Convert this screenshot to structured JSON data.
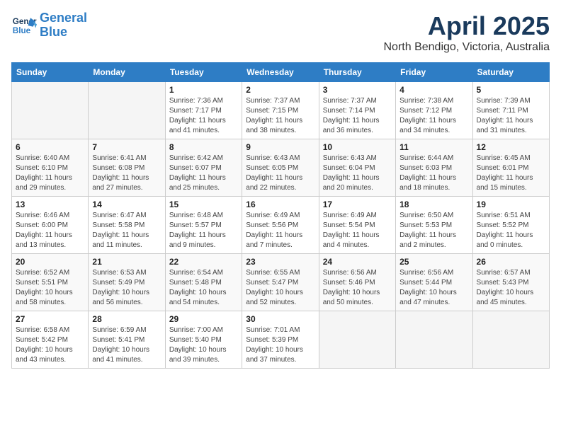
{
  "logo": {
    "line1": "General",
    "line2": "Blue"
  },
  "title": "April 2025",
  "subtitle": "North Bendigo, Victoria, Australia",
  "days_header": [
    "Sunday",
    "Monday",
    "Tuesday",
    "Wednesday",
    "Thursday",
    "Friday",
    "Saturday"
  ],
  "weeks": [
    [
      {
        "day": "",
        "info": ""
      },
      {
        "day": "",
        "info": ""
      },
      {
        "day": "1",
        "info": "Sunrise: 7:36 AM\nSunset: 7:17 PM\nDaylight: 11 hours and 41 minutes."
      },
      {
        "day": "2",
        "info": "Sunrise: 7:37 AM\nSunset: 7:15 PM\nDaylight: 11 hours and 38 minutes."
      },
      {
        "day": "3",
        "info": "Sunrise: 7:37 AM\nSunset: 7:14 PM\nDaylight: 11 hours and 36 minutes."
      },
      {
        "day": "4",
        "info": "Sunrise: 7:38 AM\nSunset: 7:12 PM\nDaylight: 11 hours and 34 minutes."
      },
      {
        "day": "5",
        "info": "Sunrise: 7:39 AM\nSunset: 7:11 PM\nDaylight: 11 hours and 31 minutes."
      }
    ],
    [
      {
        "day": "6",
        "info": "Sunrise: 6:40 AM\nSunset: 6:10 PM\nDaylight: 11 hours and 29 minutes."
      },
      {
        "day": "7",
        "info": "Sunrise: 6:41 AM\nSunset: 6:08 PM\nDaylight: 11 hours and 27 minutes."
      },
      {
        "day": "8",
        "info": "Sunrise: 6:42 AM\nSunset: 6:07 PM\nDaylight: 11 hours and 25 minutes."
      },
      {
        "day": "9",
        "info": "Sunrise: 6:43 AM\nSunset: 6:05 PM\nDaylight: 11 hours and 22 minutes."
      },
      {
        "day": "10",
        "info": "Sunrise: 6:43 AM\nSunset: 6:04 PM\nDaylight: 11 hours and 20 minutes."
      },
      {
        "day": "11",
        "info": "Sunrise: 6:44 AM\nSunset: 6:03 PM\nDaylight: 11 hours and 18 minutes."
      },
      {
        "day": "12",
        "info": "Sunrise: 6:45 AM\nSunset: 6:01 PM\nDaylight: 11 hours and 15 minutes."
      }
    ],
    [
      {
        "day": "13",
        "info": "Sunrise: 6:46 AM\nSunset: 6:00 PM\nDaylight: 11 hours and 13 minutes."
      },
      {
        "day": "14",
        "info": "Sunrise: 6:47 AM\nSunset: 5:58 PM\nDaylight: 11 hours and 11 minutes."
      },
      {
        "day": "15",
        "info": "Sunrise: 6:48 AM\nSunset: 5:57 PM\nDaylight: 11 hours and 9 minutes."
      },
      {
        "day": "16",
        "info": "Sunrise: 6:49 AM\nSunset: 5:56 PM\nDaylight: 11 hours and 7 minutes."
      },
      {
        "day": "17",
        "info": "Sunrise: 6:49 AM\nSunset: 5:54 PM\nDaylight: 11 hours and 4 minutes."
      },
      {
        "day": "18",
        "info": "Sunrise: 6:50 AM\nSunset: 5:53 PM\nDaylight: 11 hours and 2 minutes."
      },
      {
        "day": "19",
        "info": "Sunrise: 6:51 AM\nSunset: 5:52 PM\nDaylight: 11 hours and 0 minutes."
      }
    ],
    [
      {
        "day": "20",
        "info": "Sunrise: 6:52 AM\nSunset: 5:51 PM\nDaylight: 10 hours and 58 minutes."
      },
      {
        "day": "21",
        "info": "Sunrise: 6:53 AM\nSunset: 5:49 PM\nDaylight: 10 hours and 56 minutes."
      },
      {
        "day": "22",
        "info": "Sunrise: 6:54 AM\nSunset: 5:48 PM\nDaylight: 10 hours and 54 minutes."
      },
      {
        "day": "23",
        "info": "Sunrise: 6:55 AM\nSunset: 5:47 PM\nDaylight: 10 hours and 52 minutes."
      },
      {
        "day": "24",
        "info": "Sunrise: 6:56 AM\nSunset: 5:46 PM\nDaylight: 10 hours and 50 minutes."
      },
      {
        "day": "25",
        "info": "Sunrise: 6:56 AM\nSunset: 5:44 PM\nDaylight: 10 hours and 47 minutes."
      },
      {
        "day": "26",
        "info": "Sunrise: 6:57 AM\nSunset: 5:43 PM\nDaylight: 10 hours and 45 minutes."
      }
    ],
    [
      {
        "day": "27",
        "info": "Sunrise: 6:58 AM\nSunset: 5:42 PM\nDaylight: 10 hours and 43 minutes."
      },
      {
        "day": "28",
        "info": "Sunrise: 6:59 AM\nSunset: 5:41 PM\nDaylight: 10 hours and 41 minutes."
      },
      {
        "day": "29",
        "info": "Sunrise: 7:00 AM\nSunset: 5:40 PM\nDaylight: 10 hours and 39 minutes."
      },
      {
        "day": "30",
        "info": "Sunrise: 7:01 AM\nSunset: 5:39 PM\nDaylight: 10 hours and 37 minutes."
      },
      {
        "day": "",
        "info": ""
      },
      {
        "day": "",
        "info": ""
      },
      {
        "day": "",
        "info": ""
      }
    ]
  ]
}
